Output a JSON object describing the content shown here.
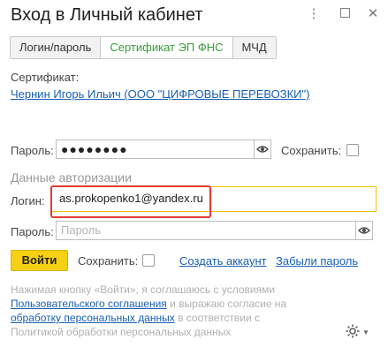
{
  "window": {
    "title": "Вход в Личный кабинет",
    "menu_glyph": "⋮",
    "close_glyph": "✕"
  },
  "tabs": [
    {
      "label": "Логин/пароль",
      "active": false
    },
    {
      "label": "Сертификат ЭП ФНС",
      "active": true
    },
    {
      "label": "МЧД",
      "active": false
    }
  ],
  "certificate": {
    "label": "Сертификат:",
    "value": "Чернин Игорь Ильич (ООО \"ЦИФРОВЫЕ ПЕРЕВОЗКИ\")"
  },
  "cert_password": {
    "label": "Пароль:",
    "value": "●●●●●●●●",
    "save_label": "Сохранить:"
  },
  "auth": {
    "section_title": "Данные авторизации",
    "login_label": "Логин:",
    "login_value": "as.prokopenko1@yandex.ru",
    "password_label": "Пароль:",
    "password_placeholder": "Пароль"
  },
  "actions": {
    "login_button": "Войти",
    "save_label": "Сохранить:",
    "create_account": "Создать аккаунт",
    "forgot_password": "Забыли пароль"
  },
  "consent": {
    "part1": "Нажимая кнопку «Войти», я соглашаюсь с условиями ",
    "link1": "Пользовательского соглашения",
    "part2": " и выражаю согласие на ",
    "link2": "обработку персональных данных",
    "part3": " в соответствии с Политикой обработки персональных данных"
  },
  "colors": {
    "accent_green": "#3a9a3a",
    "link_blue": "#1a5fb4",
    "button_yellow": "#f5d013",
    "focus_border": "#f2c200",
    "highlight_red": "#e03c31"
  },
  "icons": {
    "menu": "kebab-menu-icon",
    "maximize": "maximize-icon",
    "close": "close-icon",
    "eye": "eye-icon",
    "settings": "gear-icon"
  }
}
